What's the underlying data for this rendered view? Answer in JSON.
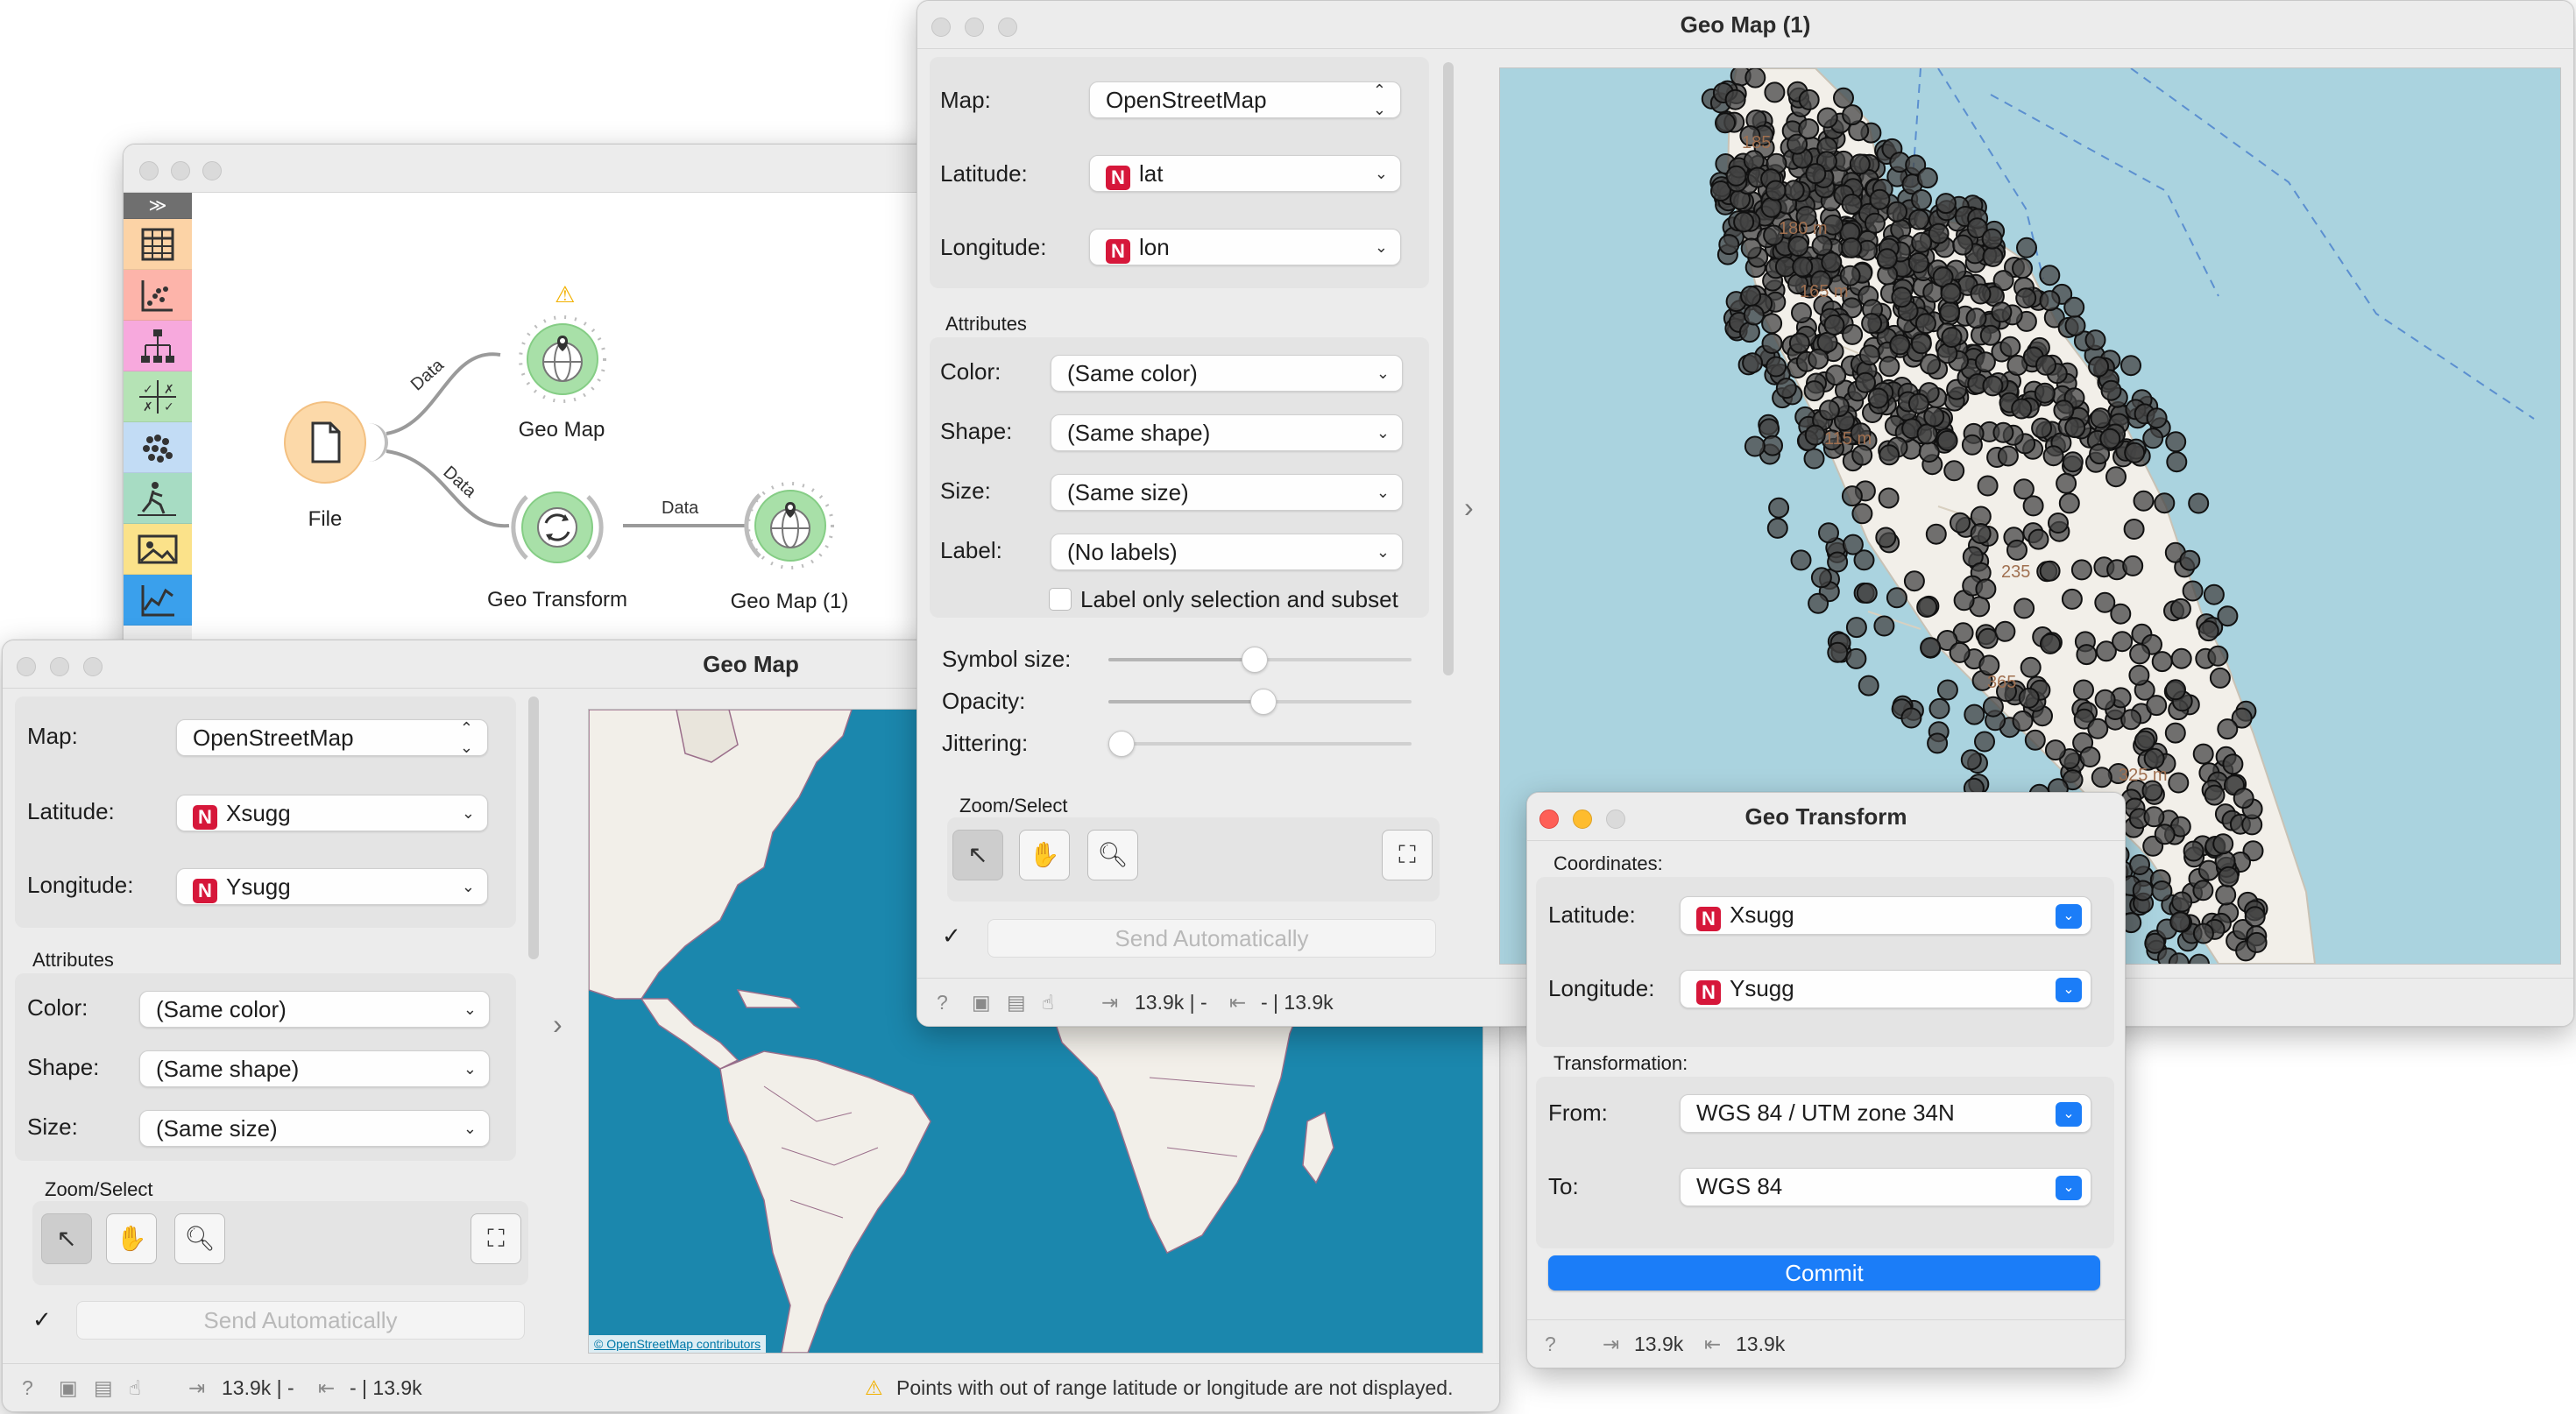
{
  "canvas_window": {
    "nodes": {
      "file": "File",
      "geo_map": "Geo Map",
      "geo_transform": "Geo Transform",
      "geo_map_1": "Geo Map (1)"
    },
    "links": {
      "file_geomap": "Data",
      "file_geotransform": "Data",
      "geotransform_geomap1": "Data"
    },
    "toolbox_expand": "≫"
  },
  "geo_map_window": {
    "title": "Geo Map",
    "map_label": "Map:",
    "map_value": "OpenStreetMap",
    "latitude_label": "Latitude:",
    "latitude_value": "Xsugg",
    "longitude_label": "Longitude:",
    "longitude_value": "Ysugg",
    "attributes_header": "Attributes",
    "color_label": "Color:",
    "color_value": "(Same color)",
    "shape_label": "Shape:",
    "shape_value": "(Same shape)",
    "size_label": "Size:",
    "size_value": "(Same size)",
    "zoom_header": "Zoom/Select",
    "send_auto": "Send Automatically",
    "attribution": "© OpenStreetMap contributors",
    "status_in": "13.9k | -",
    "status_out": "- | 13.9k",
    "warning": "Points with out of range latitude or longitude are not displayed."
  },
  "geo_map1_window": {
    "title": "Geo Map (1)",
    "map_label": "Map:",
    "map_value": "OpenStreetMap",
    "latitude_label": "Latitude:",
    "latitude_value": "lat",
    "longitude_label": "Longitude:",
    "longitude_value": "lon",
    "attributes_header": "Attributes",
    "color_label": "Color:",
    "color_value": "(Same color)",
    "shape_label": "Shape:",
    "shape_value": "(Same shape)",
    "size_label": "Size:",
    "size_value": "(Same size)",
    "label_label": "Label:",
    "label_value": "(No labels)",
    "label_only": "Label only selection and subset",
    "symbol_size": "Symbol size:",
    "symbol_size_level": 0.48,
    "opacity": "Opacity:",
    "opacity_level": 0.51,
    "jittering": "Jittering:",
    "jittering_level": 0.0,
    "zoom_header": "Zoom/Select",
    "send_auto": "Send Automatically",
    "status_in": "13.9k | -",
    "status_out": "- | 13.9k",
    "contours": [
      "185",
      "180 m",
      "165 m",
      "115 m",
      "235",
      "365",
      "325 m"
    ]
  },
  "geo_transform_window": {
    "title": "Geo Transform",
    "coordinates_header": "Coordinates:",
    "latitude_label": "Latitude:",
    "latitude_value": "Xsugg",
    "longitude_label": "Longitude:",
    "longitude_value": "Ysugg",
    "transformation_header": "Transformation:",
    "from_label": "From:",
    "from_value": "WGS 84 / UTM zone 34N",
    "to_label": "To:",
    "to_value": "WGS 84",
    "commit": "Commit",
    "status_in": "13.9k",
    "status_out": "13.9k"
  },
  "colors": {
    "accent": "#1b7df8",
    "ocean": "#aad3df",
    "map_ocean_world": "#1b87ad",
    "land": "#f2efe9",
    "numeric_badge": "#d6173a",
    "node_green": "#a8e0a8",
    "node_orange": "#fcd9a9"
  }
}
